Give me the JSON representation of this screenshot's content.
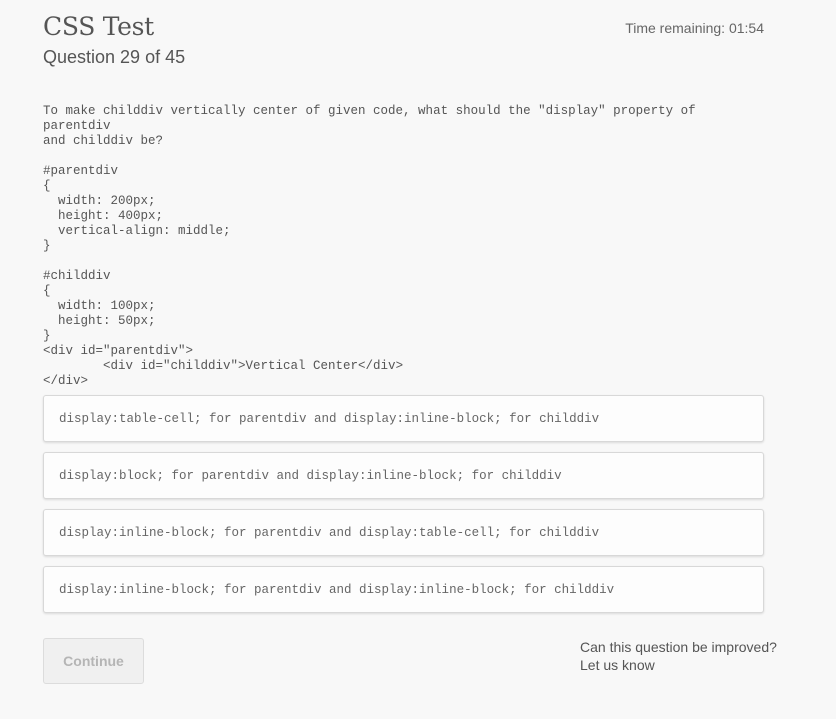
{
  "header": {
    "test_title": "CSS Test",
    "question_counter": "Question 29 of 45",
    "timer_label": "Time remaining:",
    "timer_value": "01:54"
  },
  "question": {
    "text": "To make childdiv vertically center of given code, what should the \"display\" property of parentdiv\nand childdiv be?\n\n#parentdiv\n{\n  width: 200px;\n  height: 400px;\n  vertical-align: middle;\n}\n\n#childdiv\n{\n  width: 100px;\n  height: 50px;\n}\n<div id=\"parentdiv\">\n        <div id=\"childdiv\">Vertical Center</div>\n</div>"
  },
  "answers": [
    "display:table-cell; for parentdiv and display:inline-block; for childdiv",
    "display:block; for parentdiv and display:inline-block; for childdiv",
    "display:inline-block; for parentdiv and display:table-cell; for childdiv",
    "display:inline-block; for parentdiv and display:inline-block; for childdiv"
  ],
  "footer": {
    "continue_label": "Continue",
    "feedback_question": "Can this question be improved?",
    "feedback_link": "Let us know"
  }
}
